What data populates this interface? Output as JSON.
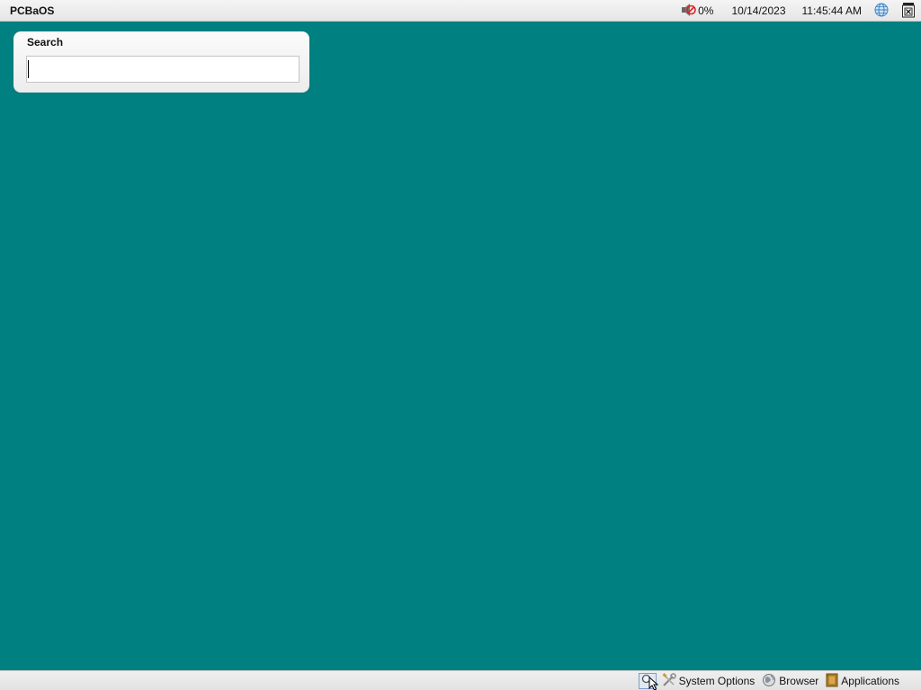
{
  "topbar": {
    "os_name": "PCBaOS",
    "volume_icon": "muted-speaker-icon",
    "volume_level": "0%",
    "date": "10/14/2023",
    "time": "11:45:44 AM",
    "network_icon": "globe-icon",
    "windows_icon": "window-list-icon"
  },
  "search_panel": {
    "title": "Search",
    "input_value": "",
    "input_placeholder": ""
  },
  "taskbar": {
    "items": [
      {
        "icon": "magnifier-icon",
        "label": ""
      },
      {
        "icon": "tools-icon",
        "label": "System Options"
      },
      {
        "icon": "globe-browser-icon",
        "label": "Browser"
      },
      {
        "icon": "applications-book-icon",
        "label": "Applications"
      }
    ]
  },
  "colors": {
    "desktop": "#008080",
    "bar": "#eeeeee",
    "panel": "#f5f5f5"
  }
}
